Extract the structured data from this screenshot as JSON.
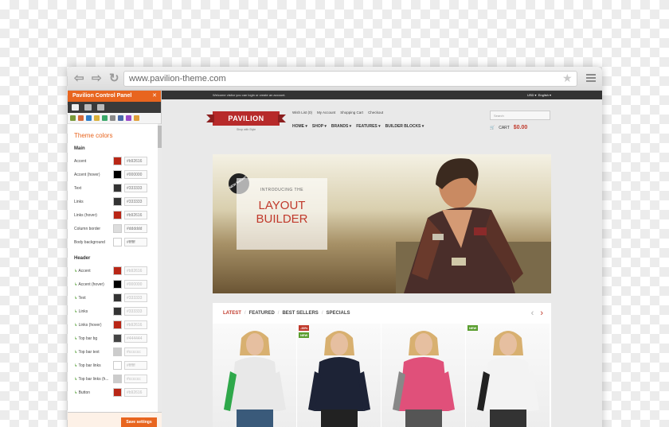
{
  "browser": {
    "url": "www.pavilion-theme.com"
  },
  "panel": {
    "title": "Pavilion Control Panel",
    "close": "✕",
    "section": "Theme colors",
    "main_label": "Main",
    "header_label": "Header",
    "main_rows": [
      {
        "label": "Accent",
        "hex": "#b92616",
        "color": "#b92616"
      },
      {
        "label": "Accent (hover)",
        "hex": "#000000",
        "color": "#000000"
      },
      {
        "label": "Text",
        "hex": "#333333",
        "color": "#333333"
      },
      {
        "label": "Links",
        "hex": "#333333",
        "color": "#333333"
      },
      {
        "label": "Links (hover)",
        "hex": "#b92616",
        "color": "#b92616"
      },
      {
        "label": "Column border",
        "hex": "#dddddd",
        "color": "#dddddd"
      },
      {
        "label": "Body background",
        "hex": "#ffffff",
        "color": "#ffffff"
      }
    ],
    "header_rows": [
      {
        "label": "Accent",
        "hex": "#b92616",
        "color": "#b92616"
      },
      {
        "label": "Accent (hover)",
        "hex": "#000000",
        "color": "#000000"
      },
      {
        "label": "Text",
        "hex": "#333333",
        "color": "#333333"
      },
      {
        "label": "Links",
        "hex": "#333333",
        "color": "#333333"
      },
      {
        "label": "Links (hover)",
        "hex": "#b92616",
        "color": "#b92616"
      },
      {
        "label": "Top bar bg",
        "hex": "#444444",
        "color": "#444444"
      },
      {
        "label": "Top bar text",
        "hex": "#cccccc",
        "color": "#cccccc"
      },
      {
        "label": "Top bar links",
        "hex": "#ffffff",
        "color": "#ffffff"
      },
      {
        "label": "Top bar links (h...",
        "hex": "#cccccc",
        "color": "#cccccc"
      },
      {
        "label": "Button",
        "hex": "#b92616",
        "color": "#b92616"
      }
    ],
    "save": "Save settings"
  },
  "site": {
    "welcome": "Welcome visitor you can login or create an account.",
    "currency": "USD ▾",
    "language": "English ▾",
    "logo": "PAVILION",
    "tagline": "Shop with Style",
    "links": [
      "Wish List (0)",
      "My Account",
      "Shopping Cart",
      "Checkout"
    ],
    "nav": [
      "HOME ▾",
      "SHOP ▾",
      "BRANDS ▾",
      "FEATURES ▾",
      "BUILDER BLOCKS ▾"
    ],
    "search_placeholder": "Search",
    "cart_label": "CART",
    "cart_total": "$0.00",
    "badge": "NEW feature!",
    "hero_small": "INTRODUCING THE",
    "hero_big": "LAYOUT BUILDER",
    "tabs": [
      "LATEST",
      "FEATURED",
      "BEST SELLERS",
      "SPECIALS"
    ],
    "prev": "‹",
    "next": "›",
    "products": [
      {
        "top": "#e8e8e8",
        "bottom": "#3a5a7a",
        "accent": "#2ea84a",
        "badges": []
      },
      {
        "top": "#1d2336",
        "bottom": "#222",
        "accent": "#1d2336",
        "badges": [
          {
            "text": "-33%",
            "color": "#c0392b"
          },
          {
            "text": "NEW",
            "color": "#5a9e2f"
          }
        ]
      },
      {
        "top": "#e0507a",
        "bottom": "#555",
        "accent": "#888",
        "badges": []
      },
      {
        "top": "#f3f3f3",
        "bottom": "#333",
        "accent": "#222",
        "badges": [
          {
            "text": "NEW",
            "color": "#5a9e2f"
          }
        ]
      }
    ]
  }
}
